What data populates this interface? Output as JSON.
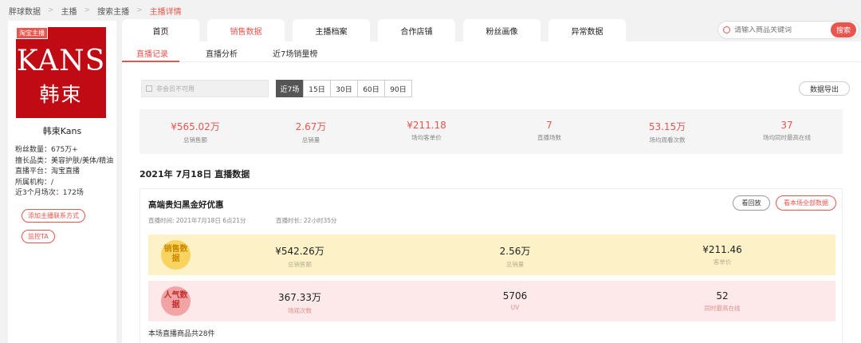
{
  "breadcrumb": {
    "items": [
      "胖球数据",
      "主播",
      "搜索主播"
    ],
    "current": "主播详情"
  },
  "profile": {
    "badge": "淘宝主播",
    "logo_text_en": "KANS",
    "logo_text_cn": "韩束",
    "name": "韩束Kans",
    "fans": "粉丝数量：675万+",
    "category": "擅长品类：美容护肤/美体/精油",
    "platform": "直播平台：淘宝直播",
    "agency": "所属机构：/",
    "sessions": "近3个月场次：172场",
    "add_contact": "添加主播联系方式",
    "monitor": "监控TA"
  },
  "tabs": [
    {
      "label": "首页"
    },
    {
      "label": "销售数据"
    },
    {
      "label": "主播档案"
    },
    {
      "label": "合作店铺"
    },
    {
      "label": "粉丝画像"
    },
    {
      "label": "异常数据"
    }
  ],
  "search": {
    "placeholder": "请输入商品关键词",
    "button": "搜索"
  },
  "subtabs": [
    "直播记录",
    "直播分析",
    "近7场销量榜"
  ],
  "date_placeholder": "非会员不可用",
  "ranges": [
    "近7场",
    "15日",
    "30日",
    "60日",
    "90日"
  ],
  "export_label": "数据导出",
  "summary": [
    {
      "value": "¥565.02万",
      "label": "总销售额"
    },
    {
      "value": "2.67万",
      "label": "总销量"
    },
    {
      "value": "¥211.18",
      "label": "场均客单价"
    },
    {
      "value": "7",
      "label": "直播场数"
    },
    {
      "value": "53.15万",
      "label": "场均观看次数"
    },
    {
      "value": "37",
      "label": "场均同时最高在线"
    }
  ],
  "section_title": "2021年 7月18日 直播数据",
  "live": {
    "title": "高端贵妇黑金好优惠",
    "time": "直播时间: 2021年7月18日 6点21分",
    "duration": "直播时长: 22小时35分",
    "replay_button": "看回放",
    "all_data_button": "看本场全部数据",
    "sales_label": "销售数据",
    "sales": [
      {
        "value": "¥542.26万",
        "label": "总销售额"
      },
      {
        "value": "2.56万",
        "label": "总销量"
      },
      {
        "value": "¥211.46",
        "label": "客单价"
      }
    ],
    "pop_label": "人气数据",
    "popularity": [
      {
        "value": "367.33万",
        "label": "场观次数"
      },
      {
        "value": "5706",
        "label": "UV"
      },
      {
        "value": "52",
        "label": "同时最高在线"
      }
    ],
    "product_count": "本场直播商品共28件"
  },
  "colors": {
    "accent": "#e8554e",
    "brand": "#c00a14",
    "sales_band": "#fdf1c7",
    "pop_band": "#fde9e9"
  }
}
